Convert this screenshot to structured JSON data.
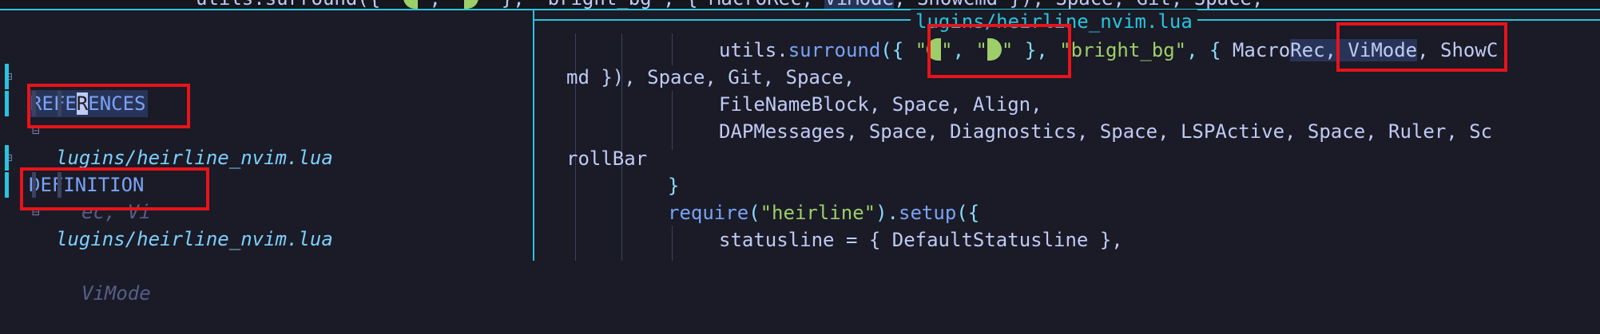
{
  "topline": {
    "text_a": "utils.surround({ \"",
    "text_b": "\", \"",
    "text_c": "\" }, \"bright_bg\", { MacroRec, ",
    "text_sel": "ViMode",
    "text_d": ", ShowCmd }), Space, Git, Space,"
  },
  "left": {
    "references_pre": "REFE",
    "references_cursor": "R",
    "references_post": "ENCES",
    "definition": "DEFINITION",
    "file1": "lugins/heirline_nvim.lua",
    "snippet1": "ec, Vi",
    "file2": "lugins/heirline_nvim.lua",
    "snippet2": "ViMode",
    "fold_glyph": "⊟"
  },
  "peek": {
    "title": "lugins/heirline_nvim.lua"
  },
  "code": {
    "l1_fn": "utils.",
    "l1_call": "surround",
    "l1_p1": "({ ",
    "l1_q1": "\"",
    "l1_q2": "\"",
    "l1_comma": ", ",
    "l1_q3": "\"",
    "l1_q4": "\"",
    "l1_p2": " },",
    "l1_str": " \"bright_bg\"",
    "l1_p3": ", { ",
    "l1_macro": "Macro",
    "l1_sel": "Rec, ViMode",
    "l1_rest": ", ShowC",
    "l2": "md }), Space, Git, Space,",
    "l3": "FileNameBlock, Space, Align,",
    "l4": "DAPMessages, Space, Diagnostics, Space, LSPActive, Space, Ruler, Sc",
    "l5": "rollBar",
    "l6": "}",
    "l7_fn": "require",
    "l7_p1": "(",
    "l7_str": "\"heirline\"",
    "l7_p2": ").",
    "l7_call": "setup",
    "l7_p3": "({",
    "l8_key": "statusline",
    "l8_rest": " = { DefaultStatusline },"
  },
  "colors": {
    "background": "#1a1b26",
    "accent": "#2ac3de",
    "highlight_box": "#e8131b",
    "string": "#9ece6a"
  }
}
